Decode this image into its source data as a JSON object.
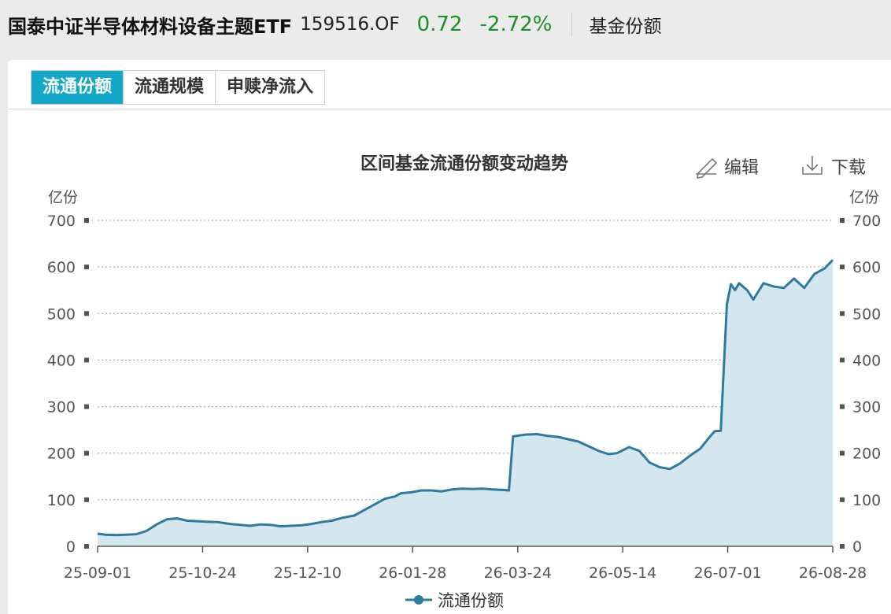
{
  "header": {
    "fund_name": "国泰中证半导体材料设备主题ETF",
    "fund_code": "159516.OF",
    "price": "0.72",
    "change": "-2.72%",
    "section": "基金份额"
  },
  "tabs": [
    {
      "label": "流通份额",
      "active": true
    },
    {
      "label": "流通规模",
      "active": false
    },
    {
      "label": "申赎净流入",
      "active": false
    }
  ],
  "toolbar": {
    "edit_label": "编辑",
    "download_label": "下载"
  },
  "colors": {
    "accent": "#15a7c7",
    "line": "#2e7aa0",
    "area": "#d4e6ee",
    "price_down": "#1e8e2a"
  },
  "chart_data": {
    "type": "area",
    "title": "区间基金流通份额变动趋势",
    "ylabel_left": "亿份",
    "ylabel_right": "亿份",
    "ylim": [
      0,
      700
    ],
    "yticks": [
      0,
      100,
      200,
      300,
      400,
      500,
      600,
      700
    ],
    "x_tick_labels": [
      "25-09-01",
      "25-10-24",
      "25-12-10",
      "26-01-28",
      "26-03-24",
      "26-05-14",
      "26-07-01",
      "26-08-28"
    ],
    "grid": true,
    "legend_position": "bottom",
    "series": [
      {
        "name": "流通份额",
        "x": [
          "2025-09-01",
          "2025-09-05",
          "2025-09-10",
          "2025-09-15",
          "2025-09-20",
          "2025-09-25",
          "2025-09-30",
          "2025-10-05",
          "2025-10-10",
          "2025-10-15",
          "2025-10-20",
          "2025-10-24",
          "2025-10-30",
          "2025-11-05",
          "2025-11-10",
          "2025-11-15",
          "2025-11-20",
          "2025-11-25",
          "2025-11-30",
          "2025-12-05",
          "2025-12-10",
          "2025-12-15",
          "2025-12-20",
          "2025-12-25",
          "2025-12-30",
          "2026-01-05",
          "2026-01-10",
          "2026-01-15",
          "2026-01-20",
          "2026-01-25",
          "2026-01-28",
          "2026-02-02",
          "2026-02-07",
          "2026-02-12",
          "2026-02-17",
          "2026-02-22",
          "2026-02-27",
          "2026-03-04",
          "2026-03-09",
          "2026-03-14",
          "2026-03-19",
          "2026-03-22",
          "2026-03-24",
          "2026-03-30",
          "2026-04-05",
          "2026-04-10",
          "2026-04-15",
          "2026-04-20",
          "2026-04-25",
          "2026-04-30",
          "2026-05-05",
          "2026-05-10",
          "2026-05-14",
          "2026-05-20",
          "2026-05-25",
          "2026-05-30",
          "2026-06-04",
          "2026-06-09",
          "2026-06-14",
          "2026-06-19",
          "2026-06-24",
          "2026-06-28",
          "2026-07-01",
          "2026-07-04",
          "2026-07-07",
          "2026-07-09",
          "2026-07-11",
          "2026-07-13",
          "2026-07-17",
          "2026-07-20",
          "2026-07-25",
          "2026-07-30",
          "2026-08-04",
          "2026-08-09",
          "2026-08-14",
          "2026-08-19",
          "2026-08-24",
          "2026-08-28"
        ],
        "values": [
          27,
          25,
          24,
          25,
          26,
          33,
          47,
          58,
          60,
          55,
          54,
          53,
          52,
          48,
          46,
          44,
          47,
          46,
          43,
          44,
          45,
          48,
          52,
          55,
          61,
          66,
          78,
          90,
          102,
          107,
          114,
          116,
          120,
          120,
          118,
          122,
          124,
          123,
          124,
          122,
          121,
          120,
          236,
          240,
          241,
          237,
          235,
          230,
          225,
          215,
          205,
          198,
          200,
          213,
          205,
          180,
          170,
          166,
          178,
          195,
          210,
          232,
          247,
          248,
          520,
          563,
          550,
          565,
          550,
          530,
          565,
          558,
          555,
          575,
          555,
          585,
          597,
          615
        ]
      }
    ]
  }
}
